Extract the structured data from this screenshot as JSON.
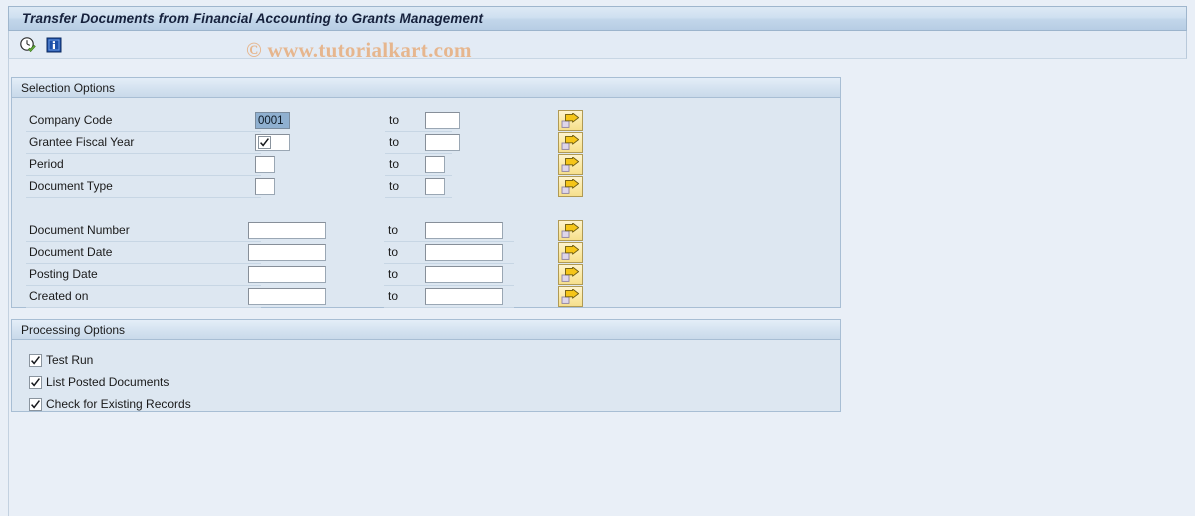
{
  "window": {
    "title": "Transfer Documents from Financial Accounting to Grants Management"
  },
  "toolbar": {
    "buttons": [
      {
        "name": "execute-icon",
        "tooltip": "Execute"
      },
      {
        "name": "info-icon",
        "tooltip": "Information"
      }
    ]
  },
  "watermark": {
    "text": "© www.tutorialkart.com",
    "color": "#e6b68e"
  },
  "selection_options": {
    "header": "Selection Options",
    "to_label": "to",
    "rows": [
      {
        "label": "Company Code",
        "value": "0001",
        "selected": true,
        "to_value": "",
        "field_width": 35,
        "to_width": 35,
        "has_arrow": true
      },
      {
        "label": "Grantee Fiscal Year",
        "value": "",
        "selected": false,
        "glyph": "checkbox-checked",
        "to_value": "",
        "field_width": 35,
        "to_width": 35,
        "has_arrow": true
      },
      {
        "label": "Period",
        "value": "",
        "selected": false,
        "to_value": "",
        "field_width": 20,
        "to_width": 20,
        "has_arrow": true
      },
      {
        "label": "Document Type",
        "value": "",
        "selected": false,
        "to_value": "",
        "field_width": 20,
        "to_width": 20,
        "has_arrow": true
      },
      {
        "label": "Document Number",
        "value": "",
        "selected": false,
        "to_value": "",
        "field_width": 78,
        "to_width": 78,
        "has_arrow": true
      },
      {
        "label": "Document Date",
        "value": "",
        "selected": false,
        "to_value": "",
        "field_width": 78,
        "to_width": 78,
        "has_arrow": true
      },
      {
        "label": "Posting Date",
        "value": "",
        "selected": false,
        "to_value": "",
        "field_width": 78,
        "to_width": 78,
        "has_arrow": true
      },
      {
        "label": "Created on",
        "value": "",
        "selected": false,
        "to_value": "",
        "field_width": 78,
        "to_width": 78,
        "has_arrow": true
      }
    ]
  },
  "processing_options": {
    "header": "Processing Options",
    "checkboxes": [
      {
        "label": "Test Run",
        "checked": true
      },
      {
        "label": "List Posted Documents",
        "checked": true
      },
      {
        "label": "Check for Existing Records",
        "checked": true
      }
    ]
  },
  "colors": {
    "page_background": "#e9eff7",
    "panel_background": "#dde7f1",
    "panel_border": "#a8bed4",
    "title_text": "#16213c",
    "selection_highlight": "#8fb0d0",
    "arrow_button": "#fbeaa8"
  }
}
